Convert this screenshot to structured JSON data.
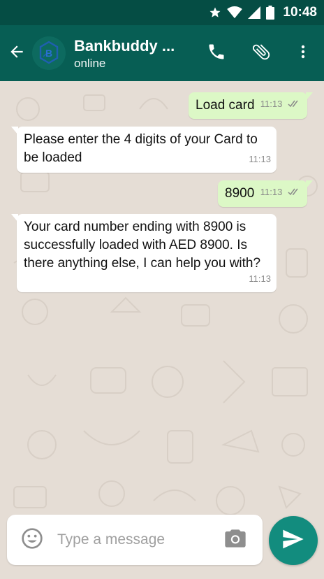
{
  "status_bar": {
    "time": "10:48",
    "icons": [
      "star-icon",
      "wifi-icon",
      "cell-signal-icon",
      "battery-icon"
    ]
  },
  "header": {
    "back_icon": "arrow-back-icon",
    "contact_name": "Bankbuddy ...",
    "status": "online",
    "actions": [
      "phone-icon",
      "paperclip-icon",
      "more-vert-icon"
    ]
  },
  "messages": [
    {
      "direction": "out",
      "text": "Load card",
      "time": "11:13",
      "receipt": "double-tick"
    },
    {
      "direction": "in",
      "text": "Please enter the 4 digits of your Card to be loaded",
      "time": "11:13"
    },
    {
      "direction": "out",
      "text": "8900",
      "time": "11:13",
      "receipt": "double-tick"
    },
    {
      "direction": "in",
      "text": "Your card number ending with 8900 is successfully loaded with AED 8900. Is there anything else, I can help you with?",
      "time": "11:13"
    }
  ],
  "composer": {
    "placeholder": "Type a message",
    "value": "",
    "emoji_icon": "emoji-icon",
    "camera_icon": "camera-icon",
    "send_icon": "send-icon"
  },
  "colors": {
    "status_bar": "#054d44",
    "app_bar": "#075e54",
    "chat_background": "#e5ddd5",
    "outgoing_bubble": "#dcf8c6",
    "incoming_bubble": "#ffffff",
    "send_button": "#128c7e"
  }
}
